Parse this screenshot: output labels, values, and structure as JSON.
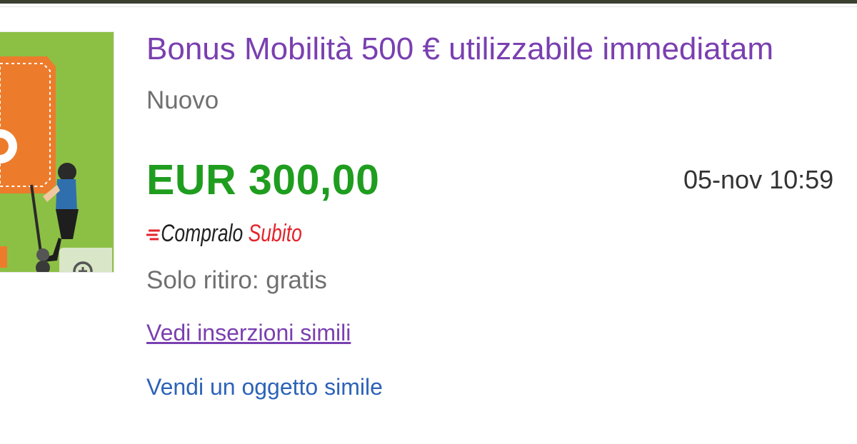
{
  "listing": {
    "title": "Bonus Mobilità 500 € utilizzabile immediatam",
    "condition": "Nuovo",
    "price": "EUR 300,00",
    "end_time": "05-nov 10:59",
    "buy_it_now_word1": "Compralo",
    "buy_it_now_word2": "Subito",
    "shipping": "Solo ritiro: gratis",
    "similar_link": "Vedi inserzioni simili",
    "sell_similar_link": "Vendi un oggetto simile"
  },
  "thumbnail": {
    "icon": "image",
    "zoom_icon": "zoom-in-icon"
  },
  "colors": {
    "title_link": "#7a3fb0",
    "price": "#1f9d1f",
    "sell_link": "#2d63b8",
    "subito_red": "#e4232b",
    "thumb_bg": "#8cc045",
    "coupon_orange": "#ec7c2c"
  }
}
